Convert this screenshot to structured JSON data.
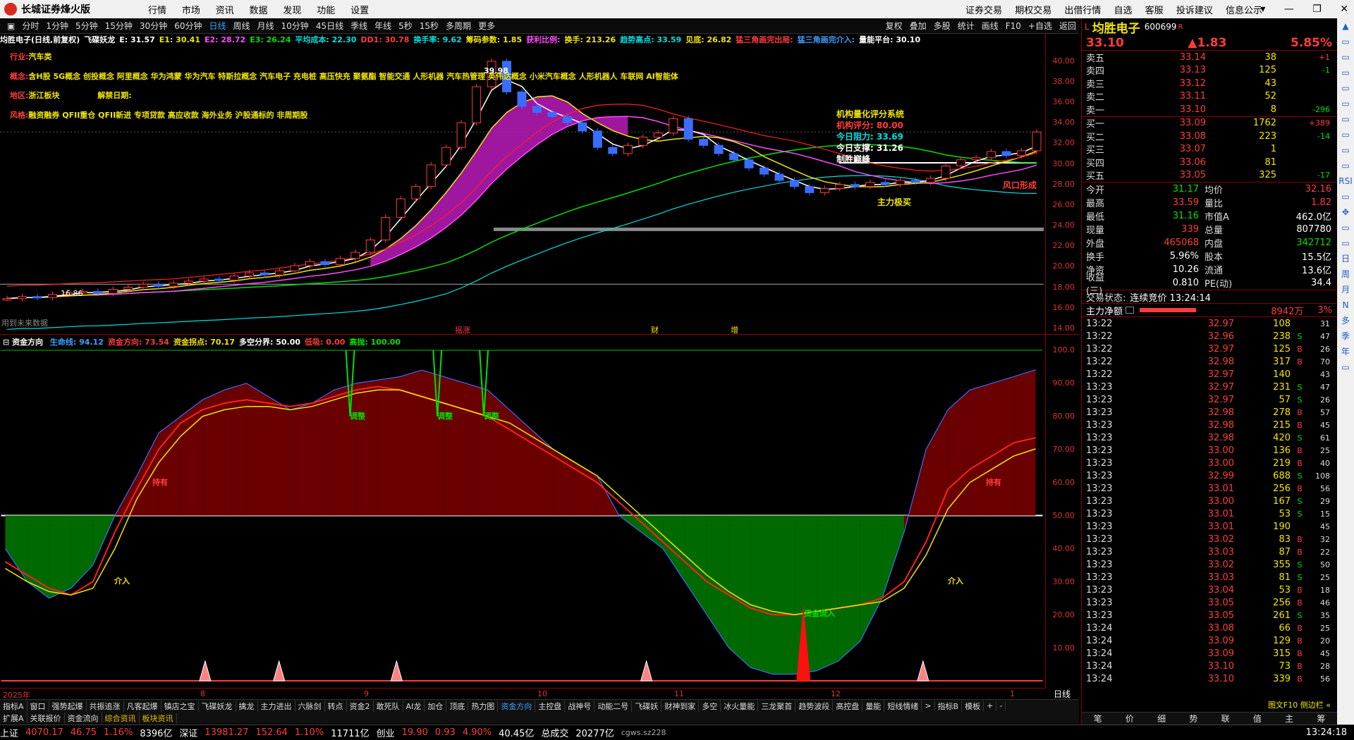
{
  "app": {
    "title": "长城证券烽火版",
    "menu": [
      "行情",
      "市场",
      "资讯",
      "数据",
      "发现",
      "功能",
      "设置"
    ],
    "right_menu": [
      "证券交易",
      "期权交易",
      "出借行情",
      "自选",
      "客服",
      "投诉建议",
      "信息公示"
    ],
    "window_buttons": [
      "▾",
      "—",
      "❐",
      "✕"
    ]
  },
  "periods": {
    "items": [
      "分时",
      "1分钟",
      "5分钟",
      "15分钟",
      "30分钟",
      "60分钟",
      "日线",
      "周线",
      "月线",
      "10分钟",
      "45日线",
      "季线",
      "年线",
      "5秒",
      "15秒",
      "多周期",
      "更多"
    ],
    "active": "日线",
    "toolbar": [
      "复权",
      "叠加",
      "多股",
      "统计",
      "画线",
      "F10",
      "+自选",
      "返回"
    ]
  },
  "indicator_line": [
    {
      "text": "均胜电子(日线,前复权)",
      "color": "#ffffff"
    },
    {
      "text": "飞碟妖龙",
      "color": "#ffffff"
    },
    {
      "text": "E: 31.57",
      "color": "#ffffff"
    },
    {
      "text": "E1: 30.41",
      "color": "#f2e600"
    },
    {
      "text": "E2: 28.72",
      "color": "#ff4cff"
    },
    {
      "text": "E3: 26.24",
      "color": "#00e000"
    },
    {
      "text": "平均成本: 22.30",
      "color": "#00e0e0"
    },
    {
      "text": "DD1: 30.78",
      "color": "#ff3c3c"
    },
    {
      "text": "换手率: 9.62",
      "color": "#00e0e0"
    },
    {
      "text": "筹码参数: 1.85",
      "color": "#f2e600"
    },
    {
      "text": "获利比例:",
      "color": "#ff4cff"
    },
    {
      "text": "换手: 213.26",
      "color": "#f2e600"
    },
    {
      "text": "趋势高点: 33.59",
      "color": "#00e0e0"
    },
    {
      "text": "见底: 26.82",
      "color": "#f2e600"
    },
    {
      "text": "猛三角画完出局:",
      "color": "#ff3c3c"
    },
    {
      "text": "猛三角画完介入:",
      "color": "#3ea0ff"
    },
    {
      "text": "量能平台: 30.10",
      "color": "#ffffff"
    }
  ],
  "info_overlay": {
    "industry_label": "行业:",
    "industry": "汽车类",
    "concept_label": "概念:",
    "concept": "含H股 5G概念 创投概念 阿里概念 华为鸿蒙 华为汽车 特斯拉概念 汽车电子 充电桩 高压快充 聚氨酯 智能交通 人形机器 汽车热管理 英伟达概念 小米汽车概念 人形机器人 车联网 AI智能体",
    "region_label": "地区:",
    "region": "浙江板块",
    "unlock_label": "解禁日期:",
    "style_label": "风格:",
    "style": "融资融券 QFII重仓 QFII新进 专项贷款 高应收款 海外业务 沪股通标的 非周期股"
  },
  "rating_box": {
    "title": "机构量化评分系统",
    "score_label": "机构评分:",
    "score": "80.00",
    "resistance_label": "今日阻力:",
    "resistance": "33.69",
    "support_label": "今日支撑:",
    "support": "31.26",
    "peak_label": "制胜巅峰"
  },
  "main_chart_labels": {
    "high_price": "39.98",
    "low_price": "16.86",
    "no_data": "用到未来数据",
    "fund_label": "主力极买",
    "risk_label": "风口形成",
    "bottom_markers": [
      "摇涨",
      "财",
      "增"
    ]
  },
  "main_axis": [
    "40.00",
    "38.00",
    "36.00",
    "34.00",
    "32.00",
    "30.00",
    "28.00",
    "26.00",
    "24.00",
    "22.00",
    "20.00",
    "18.00",
    "16.00",
    "14.00"
  ],
  "sub_indicator": {
    "name": "资金方向",
    "items": [
      {
        "text": "生命线: 94.12",
        "color": "#3ea0ff"
      },
      {
        "text": "资金方向: 73.54",
        "color": "#ff3c3c"
      },
      {
        "text": "资金拐点: 70.17",
        "color": "#f2e600"
      },
      {
        "text": "多空分界: 50.00",
        "color": "#ffffff"
      },
      {
        "text": "低吸: 0.00",
        "color": "#ff3c3c"
      },
      {
        "text": "高抛: 100.00",
        "color": "#00e000"
      }
    ],
    "labels": {
      "adjust": "调整",
      "hold": "持有",
      "enter": "介入",
      "inflow": "资金流入"
    }
  },
  "sub_axis": [
    "100.0",
    "90.00",
    "80.00",
    "70.00",
    "60.00",
    "50.00",
    "40.00",
    "30.00",
    "20.00",
    "10.00"
  ],
  "date_axis": [
    "2025年",
    "8",
    "9",
    "10",
    "11",
    "12",
    "1"
  ],
  "day_label": "日线",
  "tabs_row1": [
    "指标A",
    "窗口",
    "强势起爆",
    "共振追涨",
    "凡客起爆",
    "镇店之宝",
    "飞碟妖龙",
    "擒龙",
    "主力进出",
    "六脉剑",
    "转点",
    "资金2",
    "敢死队",
    "AI龙",
    "加仓",
    "顶底",
    "热力图",
    "资金方向",
    "主控盘",
    "战神号",
    "动能二号",
    "飞碟妖",
    "财神到家",
    "多空",
    "冰火量能",
    "三龙聚首",
    "趋势波段",
    "高控盘",
    "量能",
    "短线情绪",
    ">",
    "指标B",
    "模板",
    "+",
    "-"
  ],
  "tabs_row1_active": "资金方向",
  "tabs_row2": [
    "扩展A",
    "关联报价",
    "资金流向",
    "综合资讯",
    "板块资讯"
  ],
  "right_panel": {
    "name": "均胜电子",
    "code": "600699",
    "badge": "R",
    "price": "33.10",
    "change": "▲1.83",
    "pct": "5.85%",
    "asks": [
      {
        "label": "卖五",
        "price": "33.14",
        "vol": "38",
        "chg": "+1"
      },
      {
        "label": "卖四",
        "price": "33.13",
        "vol": "125",
        "chg": "-1"
      },
      {
        "label": "卖三",
        "price": "33.12",
        "vol": "43",
        "chg": ""
      },
      {
        "label": "卖二",
        "price": "33.11",
        "vol": "52",
        "chg": ""
      },
      {
        "label": "卖一",
        "price": "33.10",
        "vol": "8",
        "chg": "-296"
      }
    ],
    "bids": [
      {
        "label": "买一",
        "price": "33.09",
        "vol": "1762",
        "chg": "+389"
      },
      {
        "label": "买二",
        "price": "33.08",
        "vol": "223",
        "chg": "-14"
      },
      {
        "label": "买三",
        "price": "33.07",
        "vol": "1",
        "chg": ""
      },
      {
        "label": "买四",
        "price": "33.06",
        "vol": "81",
        "chg": ""
      },
      {
        "label": "买五",
        "price": "33.05",
        "vol": "325",
        "chg": "-17"
      }
    ],
    "stats": [
      {
        "l1": "今开",
        "v1": "31.17",
        "c1": "#00e000",
        "l2": "均价",
        "v2": "32.16",
        "c2": "#ff3c3c"
      },
      {
        "l1": "最高",
        "v1": "33.59",
        "c1": "#ff3c3c",
        "l2": "量比",
        "v2": "1.82",
        "c2": "#ff3c3c"
      },
      {
        "l1": "最低",
        "v1": "31.16",
        "c1": "#00e000",
        "l2": "市值A",
        "v2": "462.0亿",
        "c2": "#ffffff"
      },
      {
        "l1": "现量",
        "v1": "339",
        "c1": "#ff3c3c",
        "l2": "总量",
        "v2": "807780",
        "c2": "#ffffff"
      },
      {
        "l1": "外盘",
        "v1": "465068",
        "c1": "#ff3c3c",
        "l2": "内盘",
        "v2": "342712",
        "c2": "#00e000"
      },
      {
        "l1": "换手",
        "v1": "5.96%",
        "c1": "#ffffff",
        "l2": "股本",
        "v2": "15.5亿",
        "c2": "#ffffff"
      },
      {
        "l1": "净资",
        "v1": "10.26",
        "c1": "#ffffff",
        "l2": "流通",
        "v2": "13.6亿",
        "c2": "#ffffff"
      },
      {
        "l1": "收益(三)",
        "v1": "0.810",
        "c1": "#ffffff",
        "l2": "PE(动)",
        "v2": "34.4",
        "c2": "#ffffff"
      }
    ],
    "trade_status_label": "交易状态:",
    "trade_status": "连续竞价 13:24:14",
    "main_net_label": "主力净额",
    "main_net": "8942万",
    "main_net_pct": "3%",
    "ticks": [
      {
        "t": "13:22",
        "p": "32.97",
        "v": "108",
        "bs": "",
        "n": "31"
      },
      {
        "t": "13:22",
        "p": "32.96",
        "v": "238",
        "bs": "S",
        "n": "47"
      },
      {
        "t": "13:22",
        "p": "32.97",
        "v": "125",
        "bs": "B",
        "n": "26"
      },
      {
        "t": "13:22",
        "p": "32.98",
        "v": "317",
        "bs": "B",
        "n": "70"
      },
      {
        "t": "13:22",
        "p": "32.97",
        "v": "140",
        "bs": "",
        "n": "43"
      },
      {
        "t": "13:23",
        "p": "32.97",
        "v": "231",
        "bs": "S",
        "n": "47"
      },
      {
        "t": "13:23",
        "p": "32.97",
        "v": "57",
        "bs": "S",
        "n": "26"
      },
      {
        "t": "13:23",
        "p": "32.98",
        "v": "278",
        "bs": "B",
        "n": "57"
      },
      {
        "t": "13:23",
        "p": "32.98",
        "v": "215",
        "bs": "B",
        "n": "45"
      },
      {
        "t": "13:23",
        "p": "32.98",
        "v": "420",
        "bs": "S",
        "n": "61"
      },
      {
        "t": "13:23",
        "p": "33.00",
        "v": "136",
        "bs": "B",
        "n": "25"
      },
      {
        "t": "13:23",
        "p": "33.00",
        "v": "219",
        "bs": "B",
        "n": "40"
      },
      {
        "t": "13:23",
        "p": "32.99",
        "v": "688",
        "bs": "S",
        "n": "108"
      },
      {
        "t": "13:23",
        "p": "33.01",
        "v": "256",
        "bs": "B",
        "n": "56"
      },
      {
        "t": "13:23",
        "p": "33.00",
        "v": "167",
        "bs": "S",
        "n": "29"
      },
      {
        "t": "13:23",
        "p": "33.01",
        "v": "53",
        "bs": "S",
        "n": "15"
      },
      {
        "t": "13:23",
        "p": "33.01",
        "v": "190",
        "bs": "",
        "n": "45"
      },
      {
        "t": "13:23",
        "p": "33.02",
        "v": "83",
        "bs": "B",
        "n": "32"
      },
      {
        "t": "13:23",
        "p": "33.03",
        "v": "87",
        "bs": "B",
        "n": "22"
      },
      {
        "t": "13:23",
        "p": "33.02",
        "v": "355",
        "bs": "S",
        "n": "50"
      },
      {
        "t": "13:23",
        "p": "33.03",
        "v": "81",
        "bs": "S",
        "n": "25"
      },
      {
        "t": "13:23",
        "p": "33.04",
        "v": "53",
        "bs": "B",
        "n": "18"
      },
      {
        "t": "13:23",
        "p": "33.05",
        "v": "256",
        "bs": "B",
        "n": "46"
      },
      {
        "t": "13:23",
        "p": "33.05",
        "v": "261",
        "bs": "S",
        "n": "35"
      },
      {
        "t": "13:24",
        "p": "33.08",
        "v": "66",
        "bs": "B",
        "n": "25"
      },
      {
        "t": "13:24",
        "p": "33.09",
        "v": "129",
        "bs": "B",
        "n": "20"
      },
      {
        "t": "13:24",
        "p": "33.09",
        "v": "315",
        "bs": "B",
        "n": "45"
      },
      {
        "t": "13:24",
        "p": "33.10",
        "v": "73",
        "bs": "B",
        "n": "28"
      },
      {
        "t": "13:24",
        "p": "33.10",
        "v": "339",
        "bs": "B",
        "n": "56"
      }
    ],
    "tabs": [
      "笔",
      "价",
      "细",
      "势",
      "联",
      "值",
      "主",
      "筹"
    ],
    "f10_link": "图文F10 侧边栏 «"
  },
  "side_toolbar": [
    "▲",
    "▭",
    "▭",
    "▭",
    "▭",
    "▭",
    "▭",
    "▭",
    "▭",
    "▭",
    "RSI",
    "▭",
    "✥",
    "▭",
    "▭",
    "日",
    "周",
    "月",
    "N",
    "多",
    "季",
    "年",
    "▭"
  ],
  "status_bar": {
    "sh_label": "上证",
    "sh": "4070.17",
    "sh_chg": "46.75",
    "sh_pct": "1.16%",
    "sh_amt": "8396亿",
    "sz_label": "深证",
    "sz": "13981.27",
    "sz_chg": "152.64",
    "sz_pct": "1.10%",
    "sz_amt": "11711亿",
    "cy_label": "创业",
    "cy": "19.90",
    "cy_chg": "0.93",
    "cy_pct": "4.90%",
    "cy_amt": "40.45亿",
    "total_label": "总成交",
    "total": "20277亿",
    "server": "cgws.sz228",
    "time": "13:24:18"
  },
  "chart_data": [
    {
      "type": "candlestick",
      "title": "均胜电子(日线,前复权)",
      "ylim": [
        14,
        41
      ],
      "points": [
        {
          "close": 16.9
        },
        {
          "close": 17.1
        },
        {
          "close": 17.0
        },
        {
          "close": 17.3
        },
        {
          "close": 17.5
        },
        {
          "close": 17.6
        },
        {
          "close": 17.4
        },
        {
          "close": 17.8
        },
        {
          "close": 18.0
        },
        {
          "close": 18.3
        },
        {
          "close": 18.1
        },
        {
          "close": 18.4
        },
        {
          "close": 18.6
        },
        {
          "close": 18.8
        },
        {
          "close": 18.7
        },
        {
          "close": 19.1
        },
        {
          "close": 19.4
        },
        {
          "close": 19.2
        },
        {
          "close": 19.6
        },
        {
          "close": 20.1
        },
        {
          "close": 20.5
        },
        {
          "close": 20.2
        },
        {
          "close": 20.8
        },
        {
          "close": 21.4
        },
        {
          "close": 22.6
        },
        {
          "close": 24.8
        },
        {
          "close": 26.6
        },
        {
          "close": 27.8
        },
        {
          "close": 29.9
        },
        {
          "close": 31.6
        },
        {
          "close": 34.0
        },
        {
          "close": 37.5
        },
        {
          "close": 39.98
        },
        {
          "close": 37.0
        },
        {
          "close": 35.6
        },
        {
          "close": 35.0
        },
        {
          "close": 34.6
        },
        {
          "close": 34.0
        },
        {
          "close": 33.2
        },
        {
          "close": 31.6
        },
        {
          "close": 31.0
        },
        {
          "close": 31.8
        },
        {
          "close": 32.6
        },
        {
          "close": 33.0
        },
        {
          "close": 34.4
        },
        {
          "close": 32.4
        },
        {
          "close": 31.8
        },
        {
          "close": 31.0
        },
        {
          "close": 30.4
        },
        {
          "close": 29.6
        },
        {
          "close": 29.0
        },
        {
          "close": 28.4
        },
        {
          "close": 27.8
        },
        {
          "close": 27.2
        },
        {
          "close": 27.6
        },
        {
          "close": 28.0
        },
        {
          "close": 27.8
        },
        {
          "close": 28.2
        },
        {
          "close": 28.0
        },
        {
          "close": 28.4
        },
        {
          "close": 28.2
        },
        {
          "close": 28.6
        },
        {
          "close": 29.8
        },
        {
          "close": 30.4
        },
        {
          "close": 30.6
        },
        {
          "close": 31.2
        },
        {
          "close": 30.8
        },
        {
          "close": 31.27
        },
        {
          "close": 33.1
        }
      ]
    },
    {
      "type": "area",
      "title": "资金方向",
      "ylim": [
        0,
        100
      ],
      "series": [
        {
          "name": "生命线",
          "values": [
            40,
            30,
            25,
            28,
            35,
            50,
            62,
            75,
            80,
            85,
            88,
            90,
            86,
            82,
            84,
            88,
            90,
            91,
            92,
            94,
            92,
            90,
            88,
            82,
            76,
            70,
            66,
            62,
            50,
            45,
            40,
            30,
            20,
            10,
            4,
            2,
            2,
            3,
            6,
            12,
            25,
            45,
            70,
            82,
            88,
            90,
            92,
            94.12
          ]
        },
        {
          "name": "资金方向",
          "values": [
            36,
            32,
            28,
            26,
            30,
            45,
            58,
            70,
            78,
            82,
            84,
            85,
            84,
            83,
            84,
            86,
            88,
            89,
            88,
            86,
            84,
            82,
            80,
            76,
            72,
            68,
            64,
            60,
            54,
            48,
            42,
            36,
            30,
            26,
            22,
            20,
            20,
            21,
            22,
            23,
            25,
            30,
            42,
            58,
            64,
            68,
            72,
            73.54
          ]
        },
        {
          "name": "资金拐点",
          "values": [
            34,
            30,
            27,
            26,
            28,
            40,
            55,
            66,
            74,
            80,
            82,
            83,
            83,
            82,
            83,
            85,
            87,
            88,
            88,
            86,
            84,
            82,
            80,
            78,
            74,
            70,
            66,
            62,
            56,
            50,
            44,
            38,
            32,
            27,
            23,
            21,
            20,
            21,
            22,
            23,
            24,
            28,
            38,
            52,
            60,
            64,
            68,
            70.17
          ]
        }
      ]
    }
  ]
}
